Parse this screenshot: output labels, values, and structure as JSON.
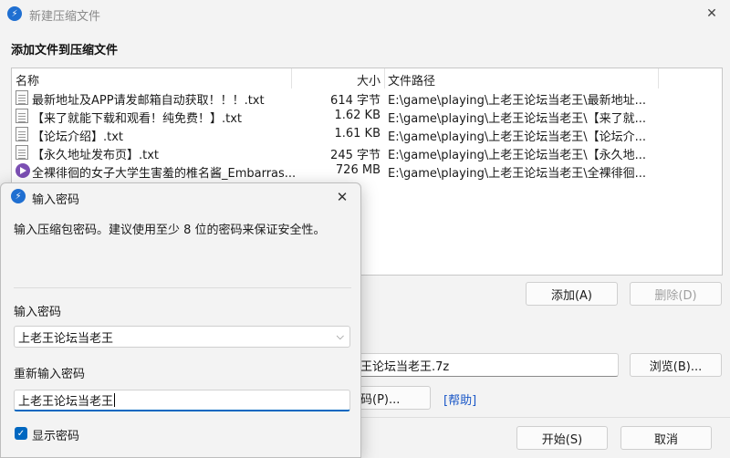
{
  "window": {
    "title": "新建压缩文件",
    "section_title": "添加文件到压缩文件"
  },
  "file_list": {
    "columns": {
      "name": "名称",
      "size": "大小",
      "path": "文件路径"
    },
    "rows": [
      {
        "name": "最新地址及APP请发邮箱自动获取！！！.txt",
        "size": "614 字节",
        "path": "E:\\game\\playing\\上老王论坛当老王\\最新地址...",
        "icon": "document-icon"
      },
      {
        "name": "【来了就能下载和观看！纯免费！】.txt",
        "size": "1.62 KB",
        "path": "E:\\game\\playing\\上老王论坛当老王\\【来了就...",
        "icon": "document-icon"
      },
      {
        "name": "【论坛介绍】.txt",
        "size": "1.61 KB",
        "path": "E:\\game\\playing\\上老王论坛当老王\\【论坛介...",
        "icon": "document-icon"
      },
      {
        "name": "【永久地址发布页】.txt",
        "size": "245 字节",
        "path": "E:\\game\\playing\\上老王论坛当老王\\【永久地...",
        "icon": "document-icon"
      },
      {
        "name": "全裸徘徊的女子大学生害羞的椎名酱_Embarras...",
        "size": "726 MB",
        "path": "E:\\game\\playing\\上老王论坛当老王\\全裸徘徊...",
        "icon": "media-file-icon"
      }
    ]
  },
  "buttons": {
    "add": "添加(A)",
    "delete": "删除(D)",
    "browse": "浏览(B)...",
    "password_partial": "码(P)...",
    "help": "[帮助]",
    "start": "开始(S)",
    "cancel": "取消"
  },
  "output": {
    "filename_partial": "王论坛当老王.7z"
  },
  "password_dialog": {
    "title": "输入密码",
    "message": "输入压缩包密码。建议使用至少 8 位的密码来保证安全性。",
    "password_label": "输入密码",
    "password_value": "上老王论坛当老王",
    "confirm_label": "重新输入密码",
    "confirm_value": "上老王论坛当老王",
    "show_password_label": "显示密码",
    "show_password_checked": true
  },
  "colors": {
    "accent": "#0067c0",
    "link": "#1a57c7",
    "window_bg": "#f3f3f3"
  }
}
